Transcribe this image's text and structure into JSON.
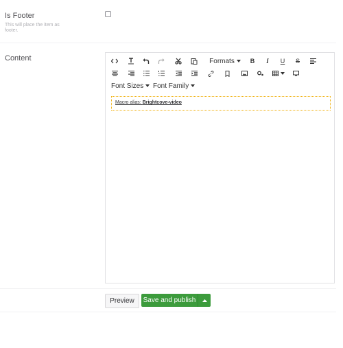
{
  "properties": {
    "is_footer": {
      "label": "Is Footer",
      "description": "This will place the item as footer.",
      "checked": false
    },
    "content": {
      "label": "Content"
    }
  },
  "toolbar": {
    "row1": [
      {
        "name": "source-code-icon",
        "glyph": "‹›"
      },
      {
        "name": "remove-format-icon",
        "glyph": "T̲ₓ"
      },
      {
        "name": "undo-icon",
        "glyph": "↶"
      },
      {
        "name": "redo-icon",
        "glyph": "↷"
      },
      {
        "name": "cut-icon",
        "glyph": "✂"
      },
      {
        "name": "paste-icon",
        "glyph": "⎘"
      }
    ],
    "formats_label": "Formats",
    "bold_icon": "B",
    "italic_icon": "I",
    "underline_icon": "U",
    "strikethrough_icon": "S",
    "row2_icons": [
      "align-left-icon",
      "align-center-icon",
      "align-right-icon",
      "bullet-list-icon",
      "numbered-list-icon",
      "outdent-icon",
      "indent-icon",
      "link-icon",
      "anchor-icon",
      "image-icon",
      "macro-icon",
      "table-icon",
      "embed-icon"
    ],
    "font_sizes_label": "Font Sizes",
    "font_family_label": "Font Family"
  },
  "editor": {
    "macro_prefix": "Macro alias:",
    "macro_alias": "Brightcove-video"
  },
  "actions": {
    "preview_label": "Preview",
    "publish_label": "Save and publish"
  }
}
